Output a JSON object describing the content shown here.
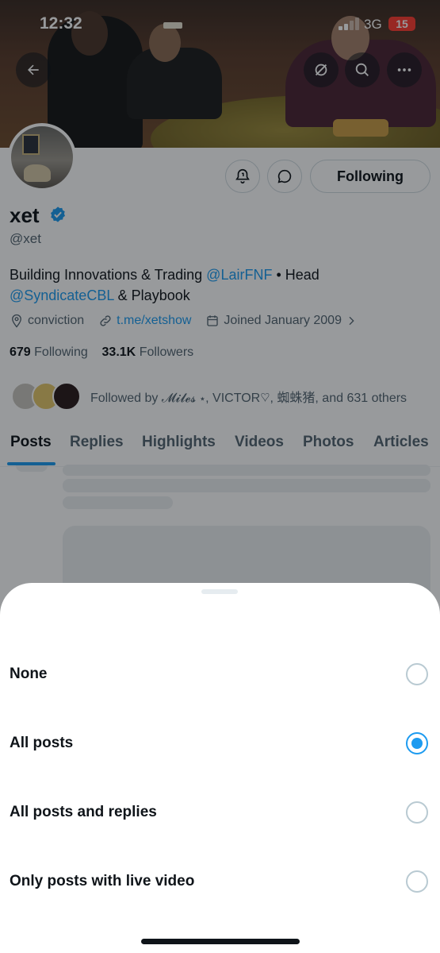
{
  "status_bar": {
    "time": "12:32",
    "network": "3G",
    "battery": "15"
  },
  "profile": {
    "name": "xet",
    "handle": "@xet",
    "bio": {
      "part1": "Building Innovations & Trading ",
      "mention1": "@LairFNF",
      "part2": " • Head ",
      "mention2": "@SyndicateCBL",
      "part3": " & Playbook"
    },
    "location": "conviction",
    "website": "t.me/xetshow",
    "joined": "Joined January 2009",
    "following_count": "679",
    "following_label": "Following",
    "followers_count": "33.1K",
    "followers_label": "Followers",
    "followed_by": "Followed by 𝓜𝓲𝓵𝓮𝓼 ⋆, VICTOR♡, 蜘蛛猪, and 631 others"
  },
  "actions": {
    "follow_label": "Following"
  },
  "tabs": [
    "Posts",
    "Replies",
    "Highlights",
    "Videos",
    "Photos",
    "Articles"
  ],
  "active_tab": "Posts",
  "sheet": {
    "options": [
      {
        "label": "None",
        "selected": false
      },
      {
        "label": "All posts",
        "selected": true
      },
      {
        "label": "All posts and replies",
        "selected": false
      },
      {
        "label": "Only posts with live video",
        "selected": false
      }
    ]
  },
  "colors": {
    "accent": "#1d9bf0",
    "text": "#0f1419",
    "muted": "#536471"
  },
  "icons": [
    "back-arrow-icon",
    "bell-off-icon",
    "search-icon",
    "more-icon",
    "notification-bell-icon",
    "message-icon",
    "verified-badge-icon",
    "location-icon",
    "link-icon",
    "calendar-icon",
    "chevron-right-icon"
  ]
}
